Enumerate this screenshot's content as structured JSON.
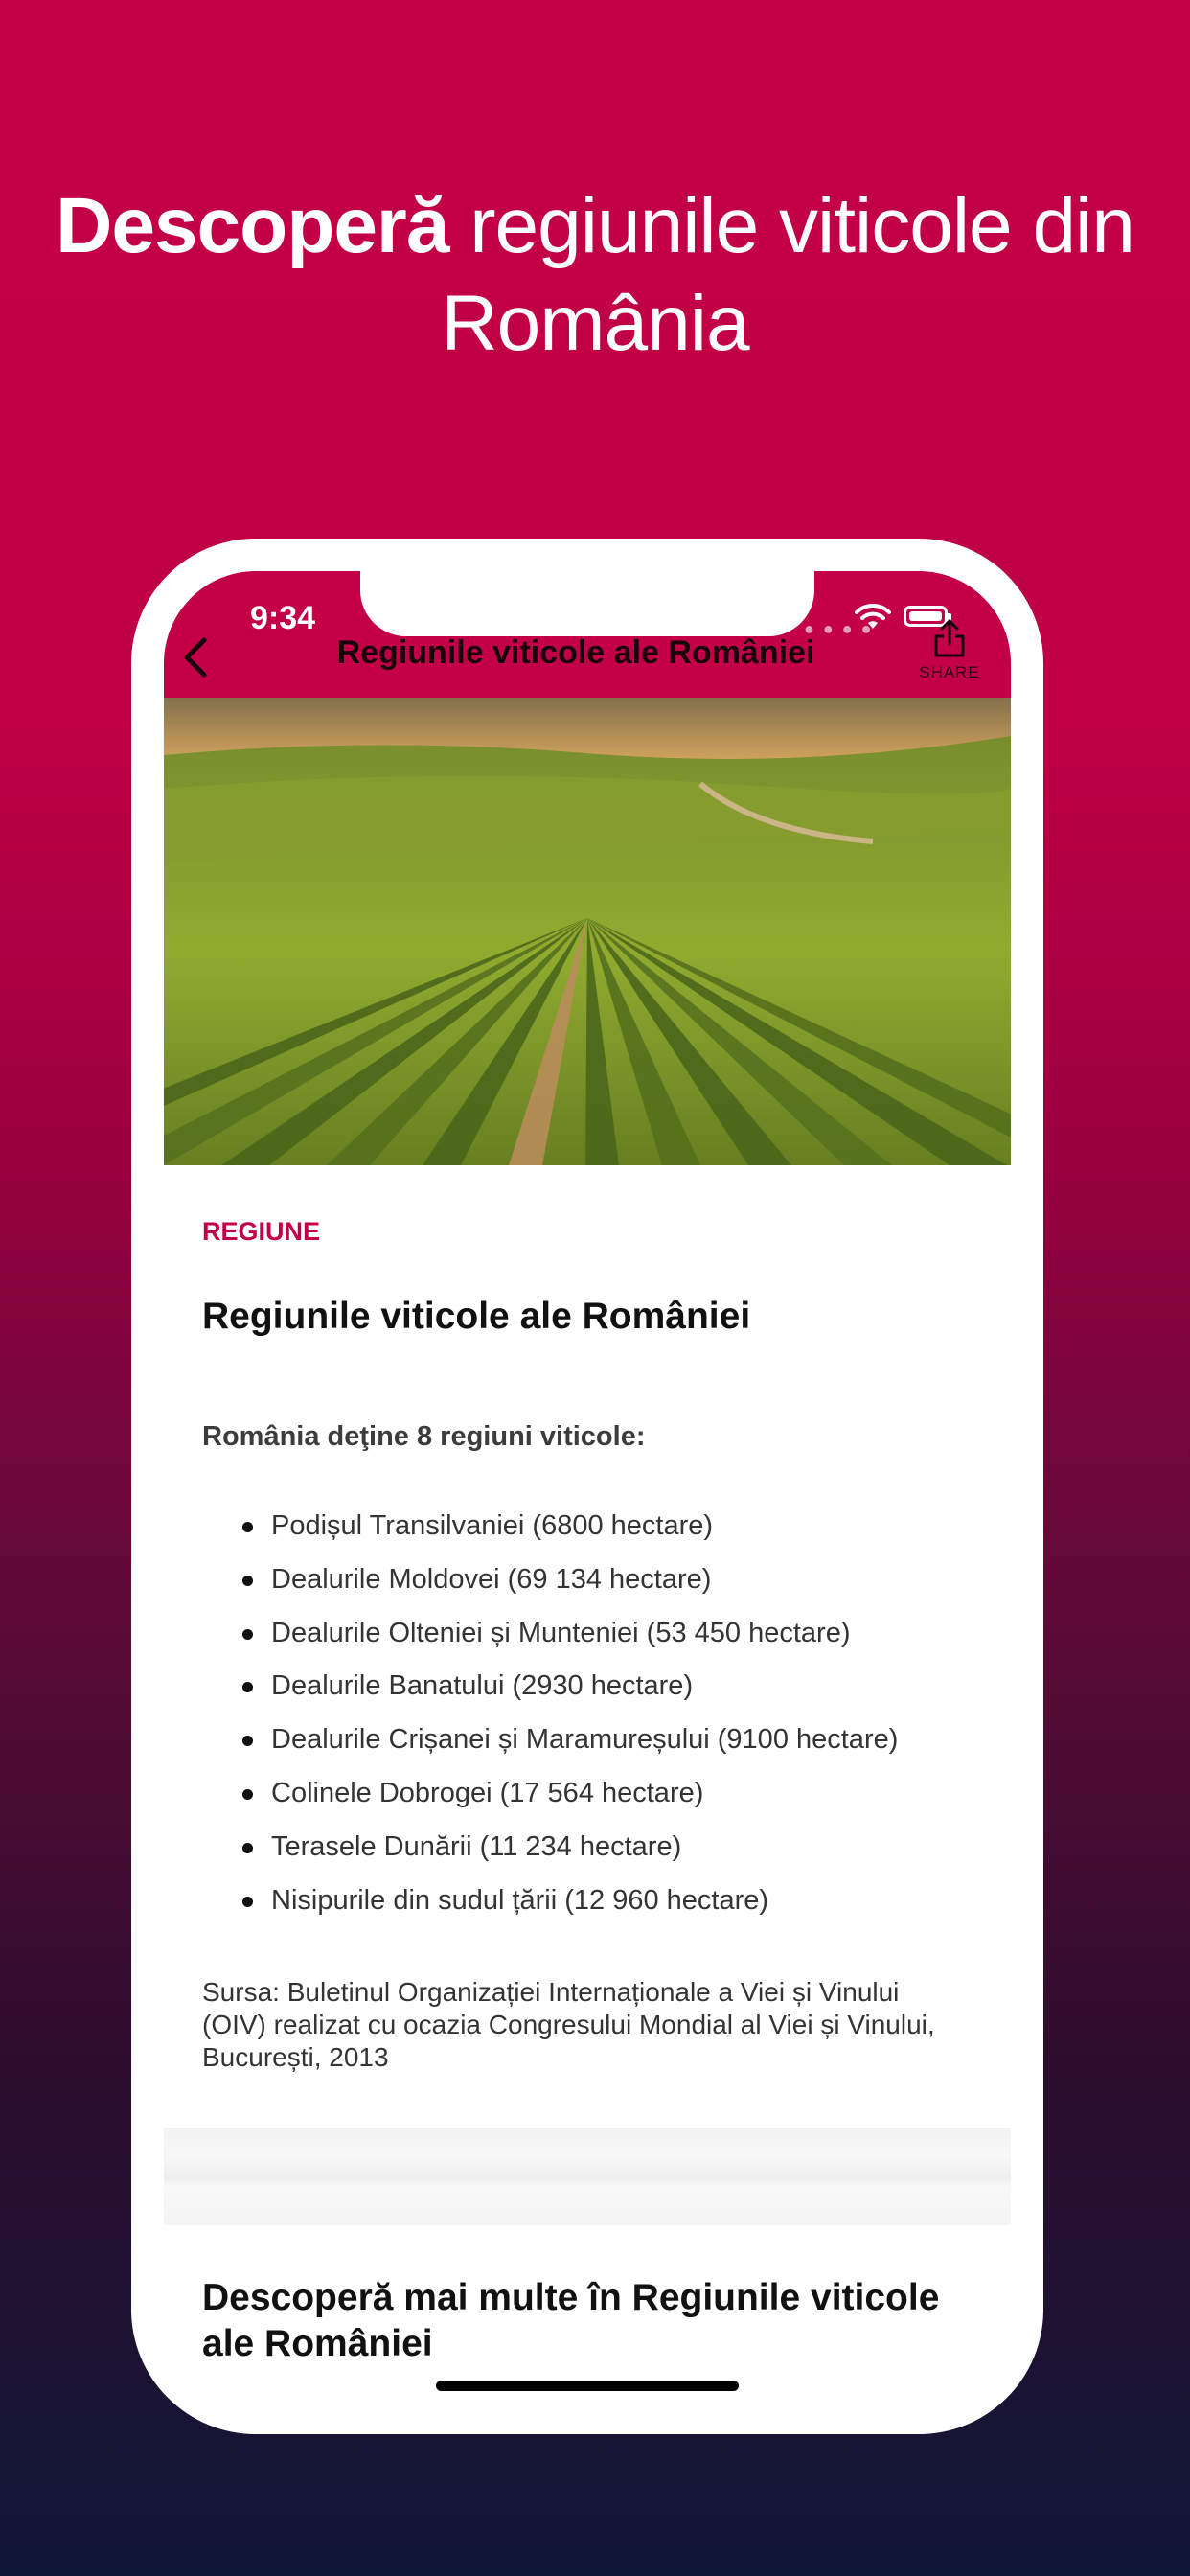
{
  "promo": {
    "headline_bold": "Descoperă",
    "headline_rest_line1": "regiunile viticole din",
    "headline_line2": "România"
  },
  "status_bar": {
    "time": "9:34"
  },
  "navbar": {
    "title": "Regiunile viticole ale României",
    "share_label": "SHARE",
    "icons": [
      "back-icon",
      "share-icon",
      "wifi-icon",
      "battery-icon"
    ]
  },
  "article": {
    "category": "REGIUNE",
    "title": "Regiunile viticole ale României",
    "intro": "România deţine 8 regiuni viticole:",
    "regions": [
      "Podișul Transilvaniei (6800 hectare)",
      "Dealurile Moldovei (69 134 hectare)",
      "Dealurile Olteniei și Munteniei (53 450 hectare)",
      "Dealurile Banatului (2930 hectare)",
      "Dealurile Crișanei și Maramureșului (9100 hectare)",
      "Colinele Dobrogei (17 564 hectare)",
      "Terasele Dunării (11 234 hectare)",
      "Nisipurile din sudul țării (12 960 hectare)"
    ],
    "source": "Sursa: Buletinul Organizației Internaționale a Viei și Vinului (OIV) realizat cu ocazia Congresului Mondial al Viei și Vinului, București, 2013"
  },
  "more_section": {
    "title": "Descoperă mai multe în Regiunile viticole ale României"
  },
  "colors": {
    "brand": "#c30045",
    "text": "#111111",
    "body_text": "#333333"
  }
}
